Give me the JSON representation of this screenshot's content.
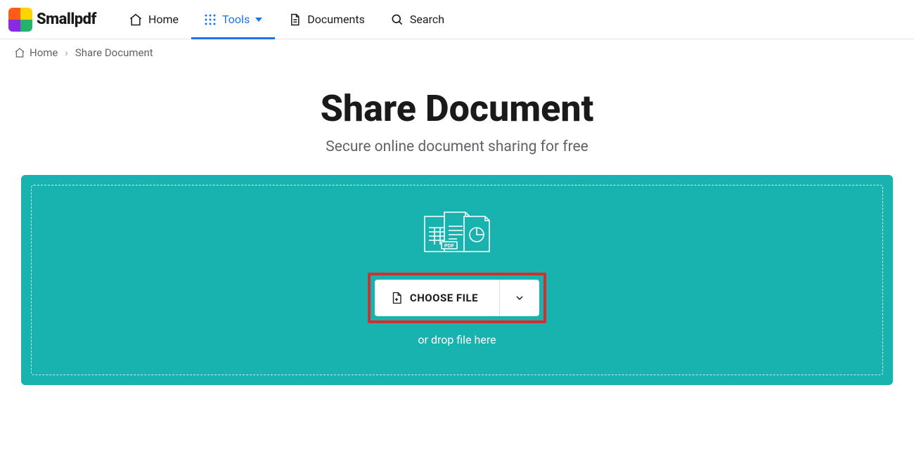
{
  "brand": {
    "name": "Smallpdf"
  },
  "nav": {
    "home": "Home",
    "tools": "Tools",
    "documents": "Documents",
    "search": "Search"
  },
  "breadcrumb": {
    "home": "Home",
    "current": "Share Document"
  },
  "page": {
    "title": "Share Document",
    "subtitle": "Secure online document sharing for free"
  },
  "dropzone": {
    "choose_label": "CHOOSE FILE",
    "hint": "or drop file here"
  }
}
